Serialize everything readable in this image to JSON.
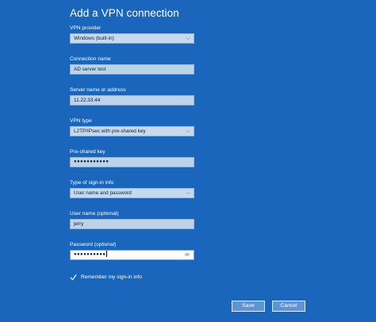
{
  "dialog": {
    "title": "Add a VPN connection"
  },
  "fields": {
    "vpn_provider": {
      "label": "VPN provider",
      "value": "Windows (built-in)"
    },
    "connection_name": {
      "label": "Connection name",
      "value": "AD server test"
    },
    "server": {
      "label": "Server name or address",
      "value": "11.22.33.44"
    },
    "vpn_type": {
      "label": "VPN type",
      "value": "L2TP/IPsec with pre-shared key"
    },
    "pre_shared_key": {
      "label": "Pre-shared key",
      "value": "●●●●●●●●●●●"
    },
    "sign_in_type": {
      "label": "Type of sign-in info",
      "value": "User name and password"
    },
    "user_name": {
      "label": "User name (optional)",
      "value": "jerry"
    },
    "password": {
      "label": "Password (optional)",
      "value": "●●●●●●●●●●"
    }
  },
  "remember": {
    "label": "Remember my sign-in info",
    "checked": true
  },
  "buttons": {
    "save": "Save",
    "cancel": "Cancel"
  },
  "icons": {
    "dropdown": "chevron-down-icon",
    "reveal": "eye-icon",
    "check": "checkmark-icon"
  },
  "colors": {
    "background": "#1a66bd",
    "field": "#bcd3ea",
    "button": "#5f95d4"
  }
}
